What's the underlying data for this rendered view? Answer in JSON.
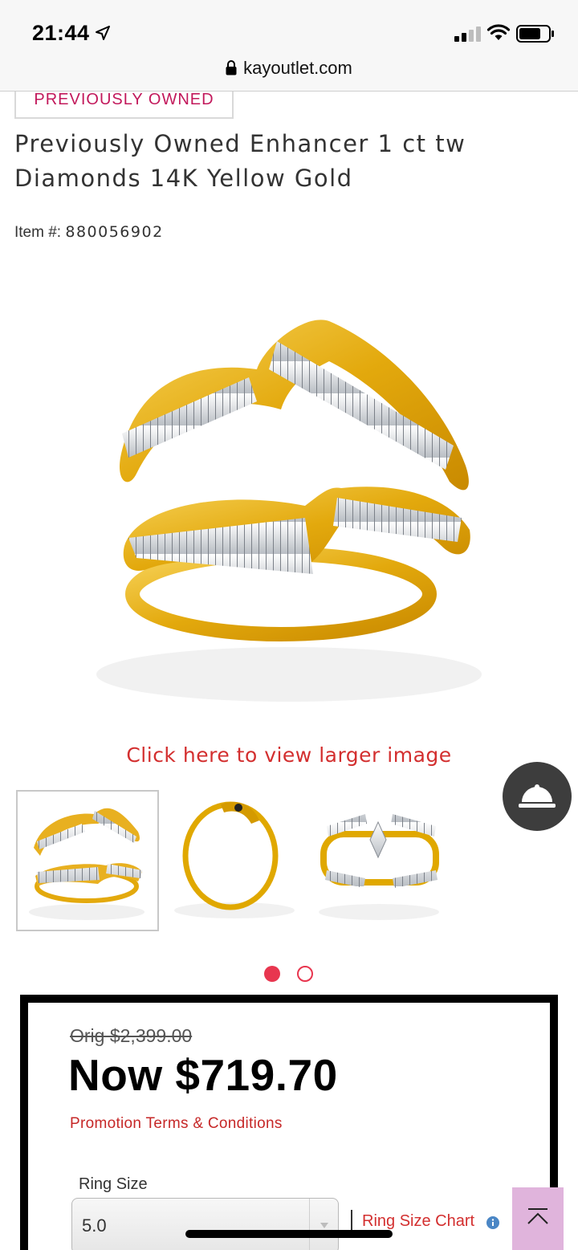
{
  "status_bar": {
    "time": "21:44",
    "icons": [
      "location-arrow-icon",
      "signal-icon",
      "wifi-icon",
      "battery-icon"
    ]
  },
  "browser": {
    "url": "kayoutlet.com",
    "lock_icon": "lock-icon"
  },
  "product": {
    "badge": "PREVIOUSLY OWNED",
    "title": "Previously Owned Enhancer 1 ct tw Diamonds 14K Yellow Gold",
    "item_label": "Item #:",
    "item_number": "880056902",
    "view_larger_link": "Click here to view larger image",
    "thumbnails": [
      "ring enhancer front view",
      "ring enhancer side view",
      "ring enhancer with engagement ring"
    ],
    "carousel_page": 1,
    "carousel_pages": 2
  },
  "pricing": {
    "original": "Orig $2,399.00",
    "now": "Now $719.70",
    "promo_link": "Promotion Terms & Conditions"
  },
  "ring_size": {
    "label": "Ring Size",
    "selected": "5.0",
    "chart_link": "Ring Size Chart"
  },
  "colors": {
    "accent_red": "#d32f2f",
    "badge_pink": "#c2185b",
    "dot_active": "#e8364f",
    "gold": "#e0a800",
    "scroll_top_bg": "#e0b4dc"
  }
}
